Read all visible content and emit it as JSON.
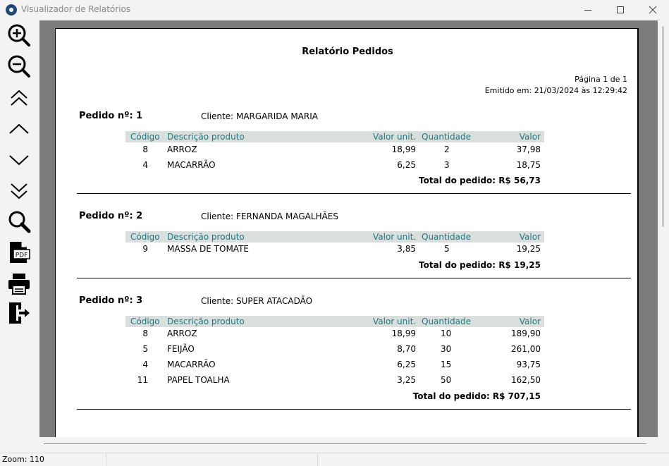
{
  "window": {
    "title": "Visualizador de Relatórios"
  },
  "toolbar": {
    "buttons": [
      {
        "name": "zoom-in"
      },
      {
        "name": "zoom-out"
      },
      {
        "name": "first-page"
      },
      {
        "name": "previous-page"
      },
      {
        "name": "next-page"
      },
      {
        "name": "last-page"
      },
      {
        "name": "search"
      },
      {
        "name": "export-pdf",
        "icon_text": "PDF"
      },
      {
        "name": "print"
      },
      {
        "name": "exit"
      }
    ]
  },
  "report": {
    "title": "Relatório Pedidos",
    "page_info": "Página 1 de 1",
    "emitted": "Emitido em: 21/03/2024 às 12:29:42",
    "headers": {
      "codigo": "Código",
      "descricao": "Descrição produto",
      "valor_unit": "Valor unit.",
      "quantidade": "Quantidade",
      "valor": "Valor"
    },
    "orders": [
      {
        "label": "Pedido nº: 1",
        "client": "Cliente: MARGARIDA MARIA",
        "items": [
          {
            "codigo": "8",
            "descricao": "ARROZ",
            "valor_unit": "18,99",
            "quantidade": "2",
            "valor": "37,98"
          },
          {
            "codigo": "4",
            "descricao": "MACARRÃO",
            "valor_unit": "6,25",
            "quantidade": "3",
            "valor": "18,75"
          }
        ],
        "total": "Total do pedido: R$ 56,73"
      },
      {
        "label": "Pedido nº: 2",
        "client": "Cliente: FERNANDA MAGALHÃES",
        "items": [
          {
            "codigo": "9",
            "descricao": "MASSA DE TOMATE",
            "valor_unit": "3,85",
            "quantidade": "5",
            "valor": "19,25"
          }
        ],
        "total": "Total do pedido: R$ 19,25"
      },
      {
        "label": "Pedido nº: 3",
        "client": "Cliente: SUPER ATACADÃO",
        "items": [
          {
            "codigo": "8",
            "descricao": "ARROZ",
            "valor_unit": "18,99",
            "quantidade": "10",
            "valor": "189,90"
          },
          {
            "codigo": "5",
            "descricao": "FEIJÃO",
            "valor_unit": "8,70",
            "quantidade": "30",
            "valor": "261,00"
          },
          {
            "codigo": "4",
            "descricao": "MACARRÃO",
            "valor_unit": "6,25",
            "quantidade": "15",
            "valor": "93,75"
          },
          {
            "codigo": "11",
            "descricao": "PAPEL TOALHA",
            "valor_unit": "3,25",
            "quantidade": "50",
            "valor": "162,50"
          }
        ],
        "total": "Total do pedido: R$ 707,15"
      }
    ]
  },
  "status": {
    "zoom": "Zoom: 110"
  }
}
